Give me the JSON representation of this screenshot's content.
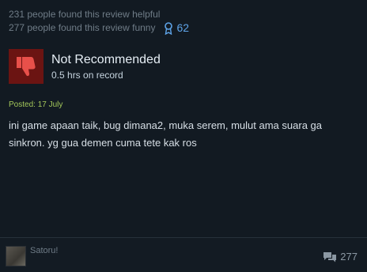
{
  "review": {
    "helpful_text": "231 people found this review helpful",
    "funny_text": "277 people found this review funny",
    "award_count": "62",
    "verdict": "Not Recommended",
    "hours": "0.5 hrs on record",
    "posted": "Posted: 17 July",
    "body": "ini game apaan taik, bug dimana2, muka serem, mulut ama suara ga sinkron. yg gua demen cuma tete kak ros"
  },
  "author": {
    "name": "Satoru!",
    "comment_count": "277"
  },
  "icons": {
    "award": "award-ribbon-icon",
    "thumb": "thumbs-down-icon",
    "comments": "comment-bubble-icon"
  },
  "colors": {
    "award": "#5ea4e8",
    "thumb_bg": "#6b1412",
    "posted": "#a3c75a"
  }
}
